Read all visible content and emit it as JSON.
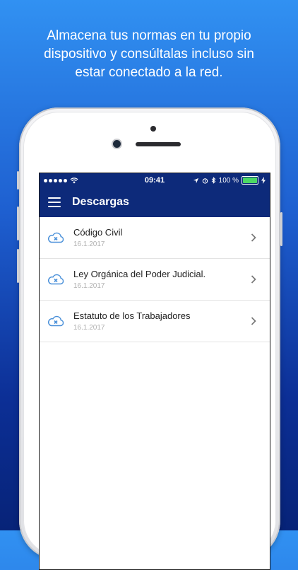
{
  "headline": {
    "line1": "Almacena tus normas en tu propio",
    "line2": "dispositivo y consúltalas incluso sin",
    "line3": "estar conectado a la red."
  },
  "status_bar": {
    "time": "09:41",
    "battery": "100 %",
    "battery_level": 1.0
  },
  "app_bar": {
    "title": "Descargas",
    "menu_icon": "hamburger-menu-icon"
  },
  "downloads": [
    {
      "title": "Código Civil",
      "date": "16.1.2017",
      "icon": "cloud-x-icon"
    },
    {
      "title": "Ley Orgánica del Poder Judicial.",
      "date": "16.1.2017",
      "icon": "cloud-x-icon"
    },
    {
      "title": "Estatuto de los Trabajadores",
      "date": "16.1.2017",
      "icon": "cloud-x-icon"
    }
  ],
  "colors": {
    "accent": "#0d2a7a",
    "icon": "#4a90d9",
    "background_top": "#3191f2",
    "background_bottom": "#072378"
  }
}
